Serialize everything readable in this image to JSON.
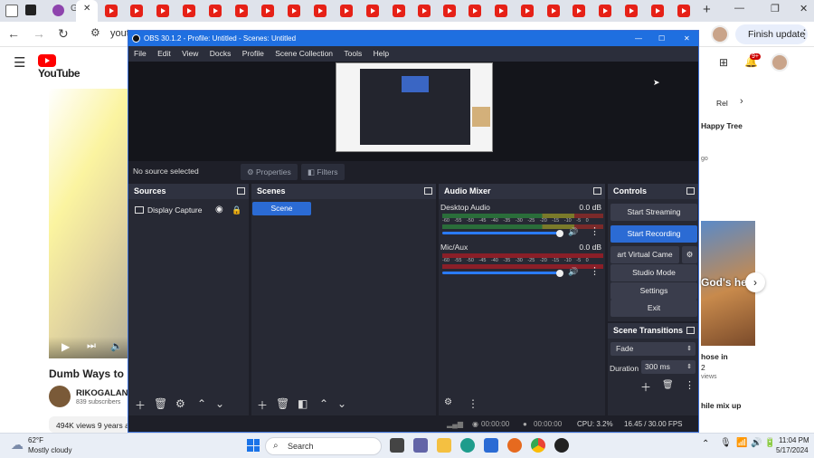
{
  "browser": {
    "update_label": "Finish update",
    "tab_close": "✕",
    "new_tab": "+",
    "omnibox_partial": "yout",
    "notifications_count": "9+"
  },
  "youtube": {
    "logo_text": "YouTube",
    "video_title_partial": "Dumb Ways to D",
    "channel_name_partial": "RIKOGALANT",
    "channel_subscribers": "839 subscribers",
    "views_partial": "494K views  9 years a",
    "right_col": {
      "chip_partial": "Rel",
      "happy_tree_partial": "Happy Tree",
      "ago_partial": "go",
      "thumb_text_partial": "God's hel",
      "shoe_partial": "hose in",
      "year_partial": "2",
      "views_partial": "views",
      "mix_partial": "hile mix up"
    }
  },
  "obs": {
    "title": "OBS 30.1.2 - Profile: Untitled - Scenes: Untitled",
    "menu": [
      "File",
      "Edit",
      "View",
      "Docks",
      "Profile",
      "Scene Collection",
      "Tools",
      "Help"
    ],
    "no_source": "No source selected",
    "properties_label": "Properties",
    "filters_label": "Filters",
    "sources": {
      "header": "Sources",
      "items": [
        {
          "label": "Display Capture"
        }
      ]
    },
    "scenes": {
      "header": "Scenes",
      "items": [
        {
          "label": "Scene",
          "selected": true
        }
      ]
    },
    "audio": {
      "header": "Audio Mixer",
      "channels": [
        {
          "name": "Desktop Audio",
          "db": "0.0 dB"
        },
        {
          "name": "Mic/Aux",
          "db": "0.0 dB"
        }
      ],
      "scale": "-60 -55 -50 -45 -40 -35 -30 -25 -20 -15 -10 -5 0"
    },
    "controls": {
      "header": "Controls",
      "start_streaming": "Start Streaming",
      "start_recording": "Start Recording",
      "virtual_camera": "art Virtual Came",
      "studio_mode": "Studio Mode",
      "settings": "Settings",
      "exit": "Exit"
    },
    "transitions": {
      "header": "Scene Transitions",
      "selected": "Fade",
      "duration_label": "Duration",
      "duration_value": "300 ms"
    },
    "status": {
      "rec_time": "00:00:00",
      "stream_time": "00:00:00",
      "cpu": "CPU: 3.2%",
      "fps": "16.45 / 30.00 FPS"
    },
    "colors": {
      "accent": "#1f6fe0",
      "bg": "#1e1f28",
      "panel": "#272934"
    }
  },
  "taskbar": {
    "weather_temp": "62°F",
    "weather_desc": "Mostly cloudy",
    "search_placeholder": "Search",
    "time": "11:04 PM",
    "date": "5/17/2024"
  }
}
